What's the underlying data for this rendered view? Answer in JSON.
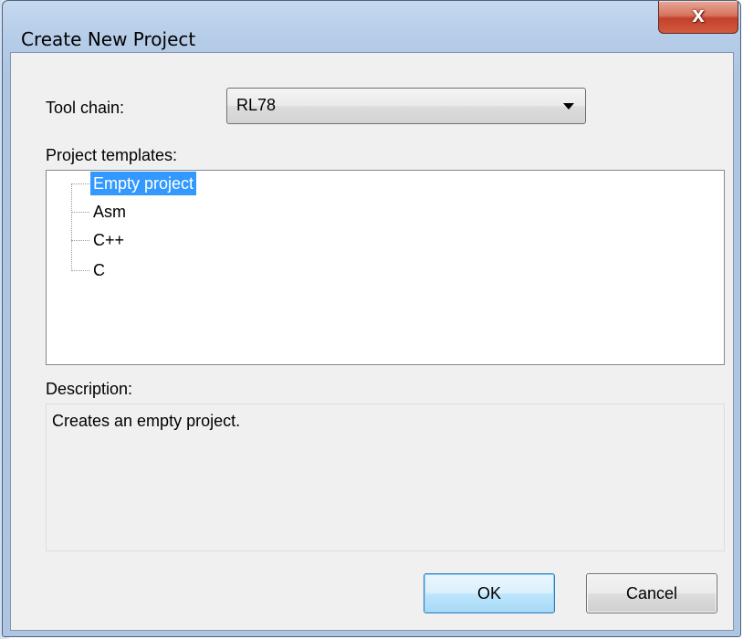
{
  "dialog": {
    "title": "Create New Project",
    "close_glyph": "x"
  },
  "toolchain": {
    "label": "Tool chain:",
    "value": "RL78"
  },
  "templates": {
    "label": "Project templates:",
    "items": [
      {
        "label": "Empty project",
        "selected": true
      },
      {
        "label": "Asm",
        "selected": false
      },
      {
        "label": "C++",
        "selected": false
      },
      {
        "label": "C",
        "selected": false
      }
    ]
  },
  "description": {
    "label": "Description:",
    "text": "Creates an empty project."
  },
  "buttons": {
    "ok": "OK",
    "cancel": "Cancel"
  },
  "colors": {
    "selection": "#3399ff",
    "close_button": "#c2412a"
  },
  "icons": {
    "close": "close-icon",
    "dropdown": "chevron-down-icon"
  }
}
